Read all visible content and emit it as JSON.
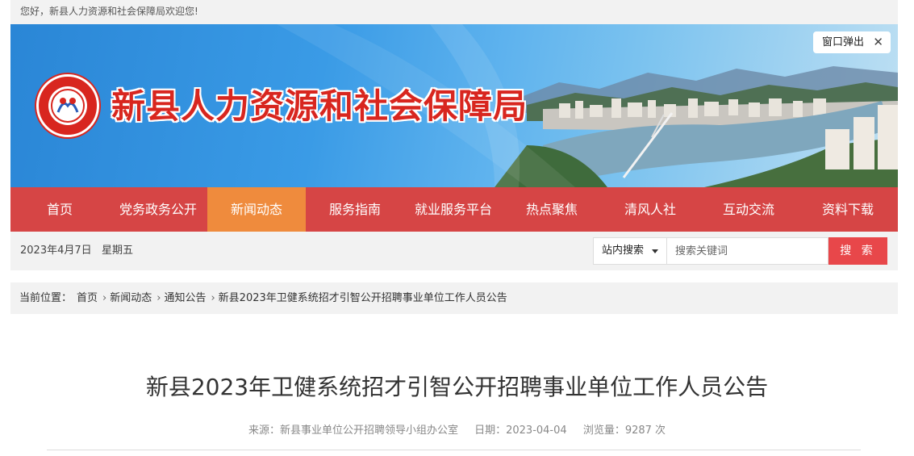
{
  "topbar": {
    "welcome": "您好，新县人力资源和社会保障局欢迎您!"
  },
  "banner": {
    "site_title": "新县人力资源和社会保障局",
    "logo_icon": "department-emblem-icon",
    "popup_label": "窗口弹出",
    "popup_close": "✕",
    "colors": {
      "title": "#d8261f",
      "sky": "#3a9be6"
    }
  },
  "nav": {
    "items": [
      {
        "label": "首页"
      },
      {
        "label": "党务政务公开"
      },
      {
        "label": "新闻动态",
        "active": true
      },
      {
        "label": "服务指南"
      },
      {
        "label": "就业服务平台"
      },
      {
        "label": "热点聚焦"
      },
      {
        "label": "清风人社"
      },
      {
        "label": "互动交流"
      },
      {
        "label": "资料下载"
      }
    ],
    "colors": {
      "bar": "#d64545",
      "active": "#ef8b3d"
    }
  },
  "datebar": {
    "date": "2023年4月7日",
    "weekday": "星期五",
    "search_scope": "站内搜索",
    "search_placeholder": "搜索关键词",
    "search_button": "搜 索"
  },
  "breadcrumb": {
    "prefix": "当前位置：",
    "items": [
      "首页",
      "新闻动态",
      "通知公告",
      "新县2023年卫健系统招才引智公开招聘事业单位工作人员公告"
    ]
  },
  "article": {
    "title": "新县2023年卫健系统招才引智公开招聘事业单位工作人员公告",
    "source": "来源：新县事业单位公开招聘领导小组办公室",
    "date": "日期：2023-04-04",
    "views": "浏览量：9287 次"
  }
}
